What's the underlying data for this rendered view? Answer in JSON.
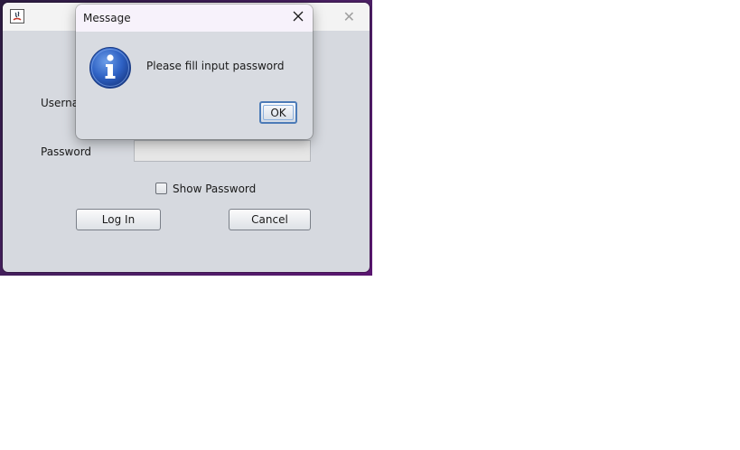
{
  "main_window": {
    "labels": {
      "username": "Userna",
      "password": "Password"
    },
    "show_password_label": "Show Password",
    "login_button": "Log In",
    "cancel_button": "Cancel"
  },
  "dialog": {
    "title": "Message",
    "message": "Please fill input password",
    "ok_button": "OK"
  }
}
